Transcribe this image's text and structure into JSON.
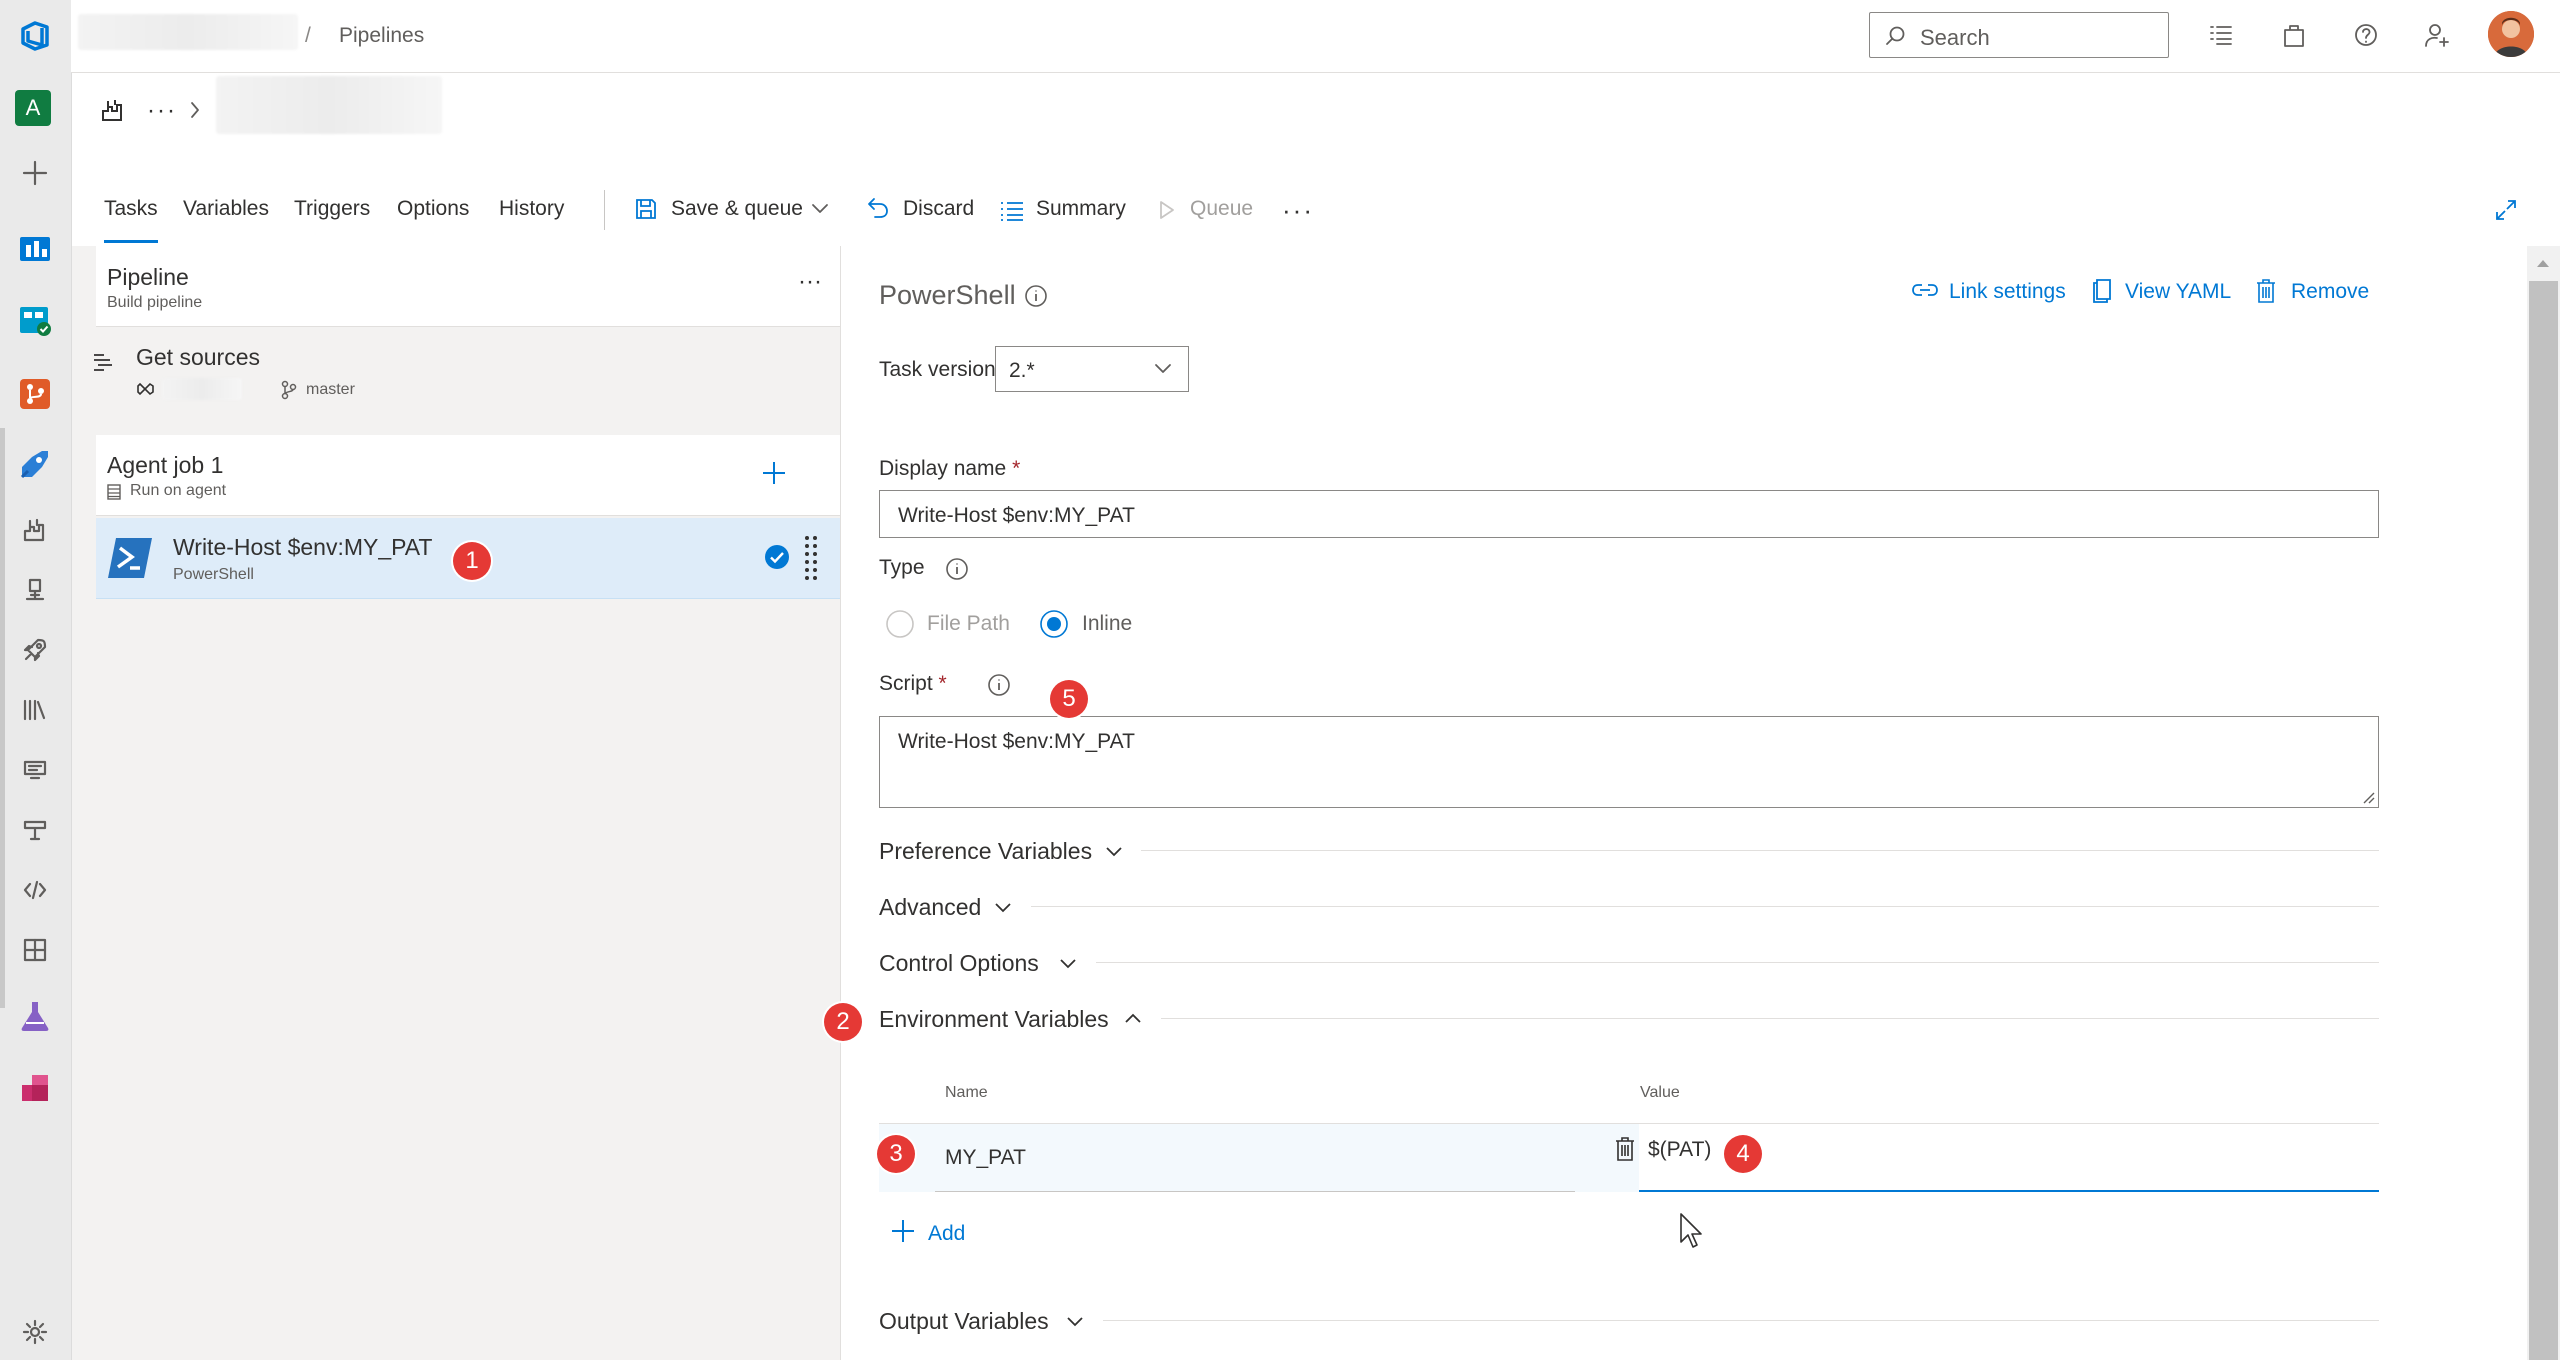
{
  "breadcrumb": {
    "separator": "/",
    "current": "Pipelines"
  },
  "search": {
    "placeholder": "Search"
  },
  "rail": {
    "org_initial": "A"
  },
  "toolbar": {
    "tabs": [
      "Tasks",
      "Variables",
      "Triggers",
      "Options",
      "History"
    ],
    "save_queue": "Save & queue",
    "discard": "Discard",
    "summary": "Summary",
    "queue": "Queue"
  },
  "pipeline": {
    "title": "Pipeline",
    "subtitle": "Build pipeline"
  },
  "get_sources": {
    "title": "Get sources",
    "branch": "master"
  },
  "agent_job": {
    "title": "Agent job 1",
    "subtitle": "Run on agent"
  },
  "task": {
    "title": "Write-Host $env:MY_PAT",
    "subtitle": "PowerShell"
  },
  "detail": {
    "title": "PowerShell",
    "link_settings": "Link settings",
    "view_yaml": "View YAML",
    "remove": "Remove",
    "task_version_label": "Task version",
    "task_version_value": "2.*",
    "display_name_label": "Display name",
    "required_mark": "*",
    "display_name_value": "Write-Host $env:MY_PAT",
    "type_label": "Type",
    "type_options": [
      "File Path",
      "Inline"
    ],
    "type_selected": "Inline",
    "script_label": "Script",
    "script_value": "Write-Host $env:MY_PAT",
    "sections": {
      "preference": "Preference Variables",
      "advanced": "Advanced",
      "control": "Control Options",
      "environment": "Environment Variables",
      "output": "Output Variables"
    },
    "env_table": {
      "name_header": "Name",
      "value_header": "Value",
      "rows": [
        {
          "name": "MY_PAT",
          "value": "$(PAT)"
        }
      ],
      "add_label": "Add"
    }
  },
  "badges": [
    "1",
    "2",
    "3",
    "4",
    "5"
  ],
  "colors": {
    "accent": "#0078d4",
    "badge": "#e53935",
    "selected_row": "#deecf9"
  }
}
